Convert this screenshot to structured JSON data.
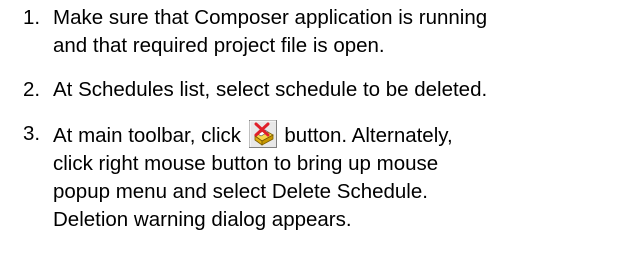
{
  "steps": [
    {
      "number": "1.",
      "lines": [
        "Make sure that Composer application is running",
        "and that required project file is open."
      ]
    },
    {
      "number": "2.",
      "lines": [
        "At Schedules list, select schedule to be deleted."
      ]
    },
    {
      "number": "3.",
      "line1_before_icon": "At main toolbar, click",
      "line1_after_icon": "button. Alternately,",
      "lines": [
        "click right mouse button to bring up mouse",
        "popup menu and select Delete Schedule.",
        "Deletion warning dialog appears."
      ],
      "icon": "delete-schedule-icon"
    }
  ],
  "colors": {
    "text": "#000000",
    "icon_cross": "#e0202a",
    "icon_box": "#f2c518",
    "icon_frame": "#808080"
  }
}
